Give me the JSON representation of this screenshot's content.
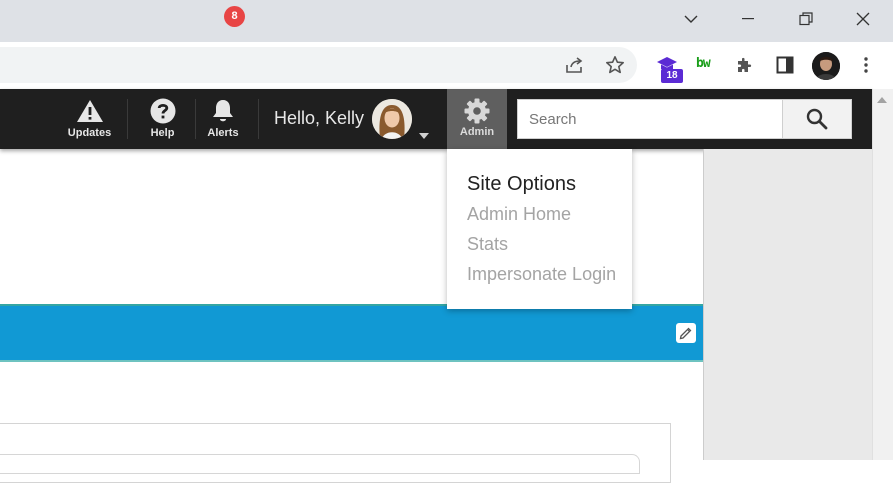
{
  "colors": {
    "header_bg": "#1f1f1f",
    "admin_active_bg": "#5f5f5f",
    "accent_blue": "#1199d4",
    "alert_badge": "#e84545",
    "menu_item_text": "#a4a4a4"
  },
  "browser": {
    "extensions": {
      "badge_count": "18",
      "bw_label": "bw"
    }
  },
  "header": {
    "nav": [
      {
        "label": "Updates",
        "icon": "warning-icon"
      },
      {
        "label": "Help",
        "icon": "help-icon"
      },
      {
        "label": "Alerts",
        "icon": "bell-icon",
        "badge": "8"
      }
    ],
    "greeting": "Hello, Kelly",
    "admin": {
      "label": "Admin",
      "icon": "gear-icon"
    },
    "search": {
      "placeholder": "Search"
    }
  },
  "dropdown": {
    "title": "Site Options",
    "items": [
      "Admin Home",
      "Stats",
      "Impersonate Login"
    ]
  }
}
